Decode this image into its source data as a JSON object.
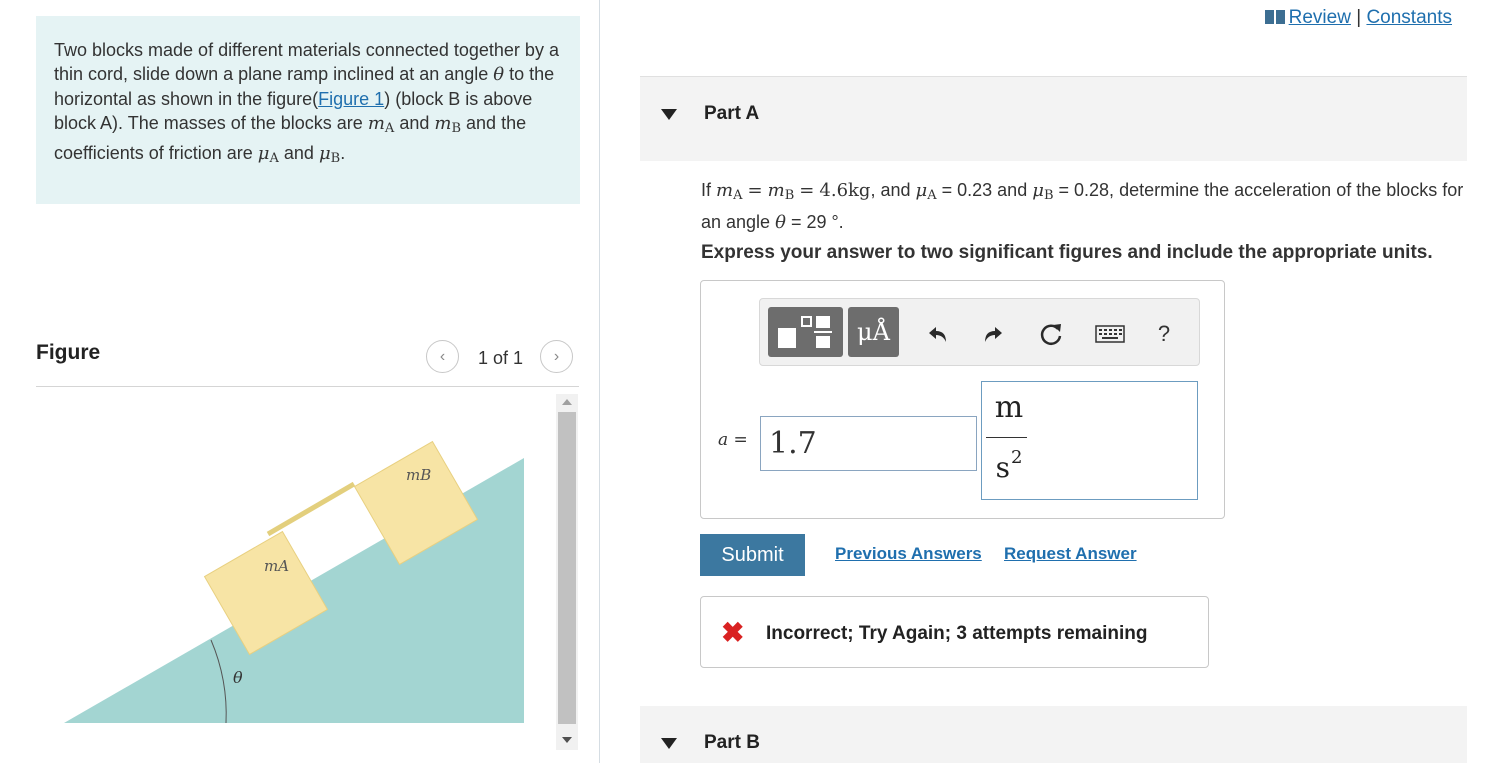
{
  "problem": {
    "intro_part1": "Two blocks made of different materials connected together by a thin cord, slide down a plane ramp inclined at an angle",
    "theta": "θ",
    "intro_part2": "to the horizontal as shown in the figure(",
    "figure_link": "Figure 1",
    "intro_part3": ") (block B is above block A). The masses of the blocks are",
    "m": "m",
    "mu": "μ",
    "sub_A": "A",
    "sub_B": "B",
    "and": "and",
    "intro_part4": "and the coefficients of friction are",
    "period": "."
  },
  "figure_panel": {
    "title": "Figure",
    "prev_icon": "chevron-left-icon",
    "next_icon": "chevron-right-icon",
    "count": "1 of 1",
    "labels": {
      "block_b": "mB",
      "block_a": "mA",
      "angle": "θ"
    },
    "colors": {
      "ramp": "#a3d5d2",
      "block": "#f7e4a5",
      "cord": "#e3cf7d"
    }
  },
  "header": {
    "book_icon": "book-icon",
    "review": "Review",
    "separator": "|",
    "constants": "Constants"
  },
  "part_a": {
    "title": "Part A",
    "q_if": "If",
    "q_eq": "=",
    "q_mass": "4.6kg",
    "q_mid": ", and",
    "q_muA": "= 0.23 and",
    "q_muB": "= 0.28, determine the acceleration of the blocks for an angle",
    "q_angle": "= 29 °.",
    "instructions": "Express your answer to two significant figures and include the appropriate units."
  },
  "toolbar": {
    "template_icon": "fraction-template-icon",
    "units_label": "μÅ",
    "undo_icon": "undo-icon",
    "redo_icon": "redo-icon",
    "reset_icon": "reset-icon",
    "keyboard_icon": "keyboard-icon",
    "help_label": "?"
  },
  "answer": {
    "variable": "a =",
    "value": "1.7",
    "unit_numerator": "m",
    "unit_denominator": "s",
    "unit_exponent": "2"
  },
  "actions": {
    "submit": "Submit",
    "previous_answers": "Previous Answers",
    "request_answer": "Request Answer"
  },
  "feedback": {
    "icon": "✖",
    "text": "Incorrect; Try Again; 3 attempts remaining"
  },
  "part_b": {
    "title": "Part B"
  },
  "colors": {
    "accent": "#3c78a0",
    "link": "#1f6fae",
    "intro_bg": "#e5f3f4",
    "error": "#d92222"
  }
}
